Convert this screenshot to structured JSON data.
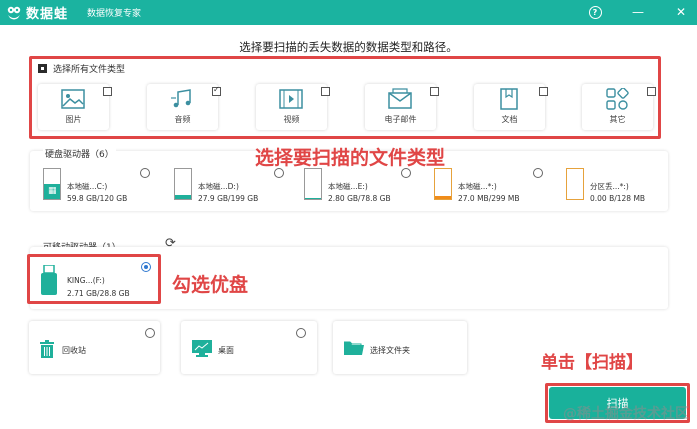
{
  "titlebar": {
    "logo_text": "数据蛙",
    "subtitle": "数据恢复专家",
    "help_glyph": "?",
    "minimize_glyph": "—",
    "close_glyph": "✕",
    "bg_color": "#1bb3a0"
  },
  "prompt": "选择要扫描的丢失数据的数据类型和路径。",
  "select_all": {
    "label": "选择所有文件类型",
    "checked": true
  },
  "file_types": [
    {
      "label": "图片",
      "icon": "image-icon",
      "checked": false
    },
    {
      "label": "音频",
      "icon": "audio-icon",
      "checked": true
    },
    {
      "label": "视频",
      "icon": "video-icon",
      "checked": false
    },
    {
      "label": "电子邮件",
      "icon": "email-icon",
      "checked": false
    },
    {
      "label": "文档",
      "icon": "document-icon",
      "checked": false
    },
    {
      "label": "其它",
      "icon": "other-icon",
      "checked": false
    }
  ],
  "hard_drives": {
    "label": "硬盘驱动器（6）",
    "drives": [
      {
        "name": "本地磁...C:)",
        "size": "59.8 GB/120 GB",
        "fill": 0.5
      },
      {
        "name": "本地磁...D:)",
        "size": "27.9 GB/199 GB",
        "fill": 0.14
      },
      {
        "name": "本地磁...E:)",
        "size": "2.80 GB/78.8 GB",
        "fill": 0.04
      },
      {
        "name": "本地磁...*:)",
        "size": "27.0 MB/299 MB",
        "fill": 0.09
      },
      {
        "name": "分区丢...*:)",
        "size": "0.00  B/128 MB",
        "fill": 0
      }
    ]
  },
  "removable": {
    "label": "可移动驱动器（1）",
    "refresh_glyph": "⟳",
    "drives": [
      {
        "name": "KING...(F:)",
        "size": "2.71 GB/28.8 GB",
        "selected": true
      }
    ]
  },
  "locations": [
    {
      "label": "回收站",
      "icon": "trash-icon"
    },
    {
      "label": "桌面",
      "icon": "desktop-icon"
    },
    {
      "label": "选择文件夹",
      "icon": "folder-icon"
    }
  ],
  "annotations": {
    "file_types": "选择要扫描的文件类型",
    "usb": "勾选优盘",
    "scan": "单击【扫描】"
  },
  "scan_button": "扫描",
  "watermark": "@稀土掘金技术社区",
  "colors": {
    "accent": "#19b19b",
    "annotation_red": "#e04646",
    "radio_blue": "#2f78d0"
  }
}
